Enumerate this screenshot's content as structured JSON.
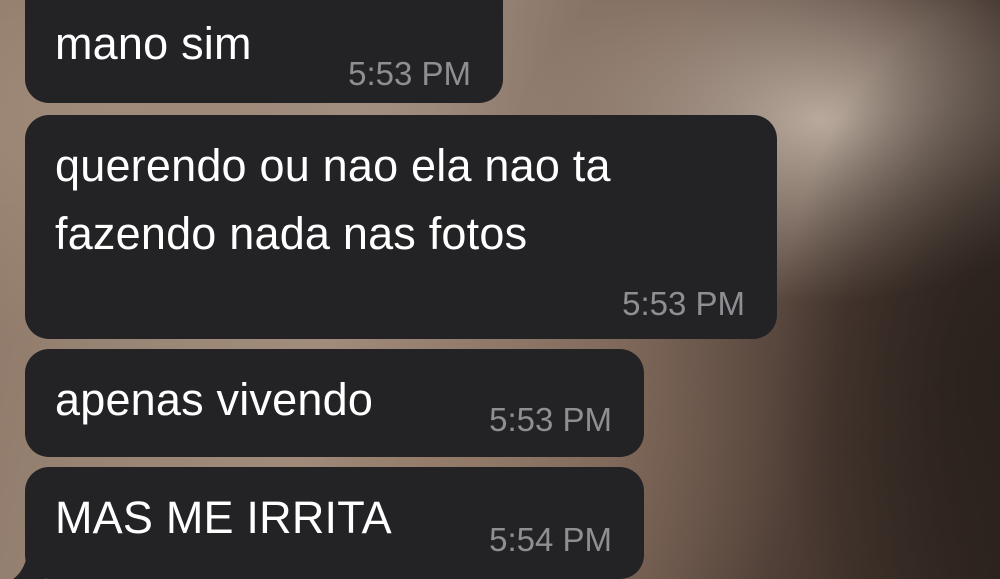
{
  "conversation": {
    "messages": [
      {
        "text_lines": [
          "mano sim"
        ],
        "time": "5:53 PM"
      },
      {
        "text_lines": [
          "querendo ou nao ela nao ta",
          "fazendo nada nas fotos"
        ],
        "time": "5:53 PM"
      },
      {
        "text_lines": [
          "apenas vivendo"
        ],
        "time": "5:53 PM"
      },
      {
        "text_lines": [
          "MAS ME IRRITA"
        ],
        "time": "5:54 PM"
      }
    ],
    "bubble_color": "#232326",
    "text_color": "#ffffff",
    "time_color": "#8e8e93",
    "reaction_icon": "heart-icon"
  }
}
